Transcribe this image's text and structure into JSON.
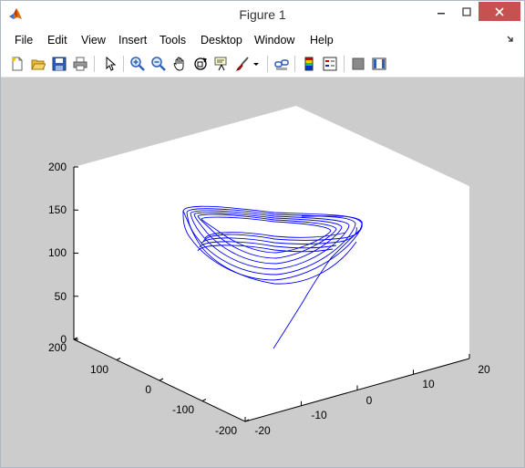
{
  "window": {
    "title": "Figure 1"
  },
  "menu": {
    "items": [
      "File",
      "Edit",
      "View",
      "Insert",
      "Tools",
      "Desktop",
      "Window",
      "Help"
    ]
  },
  "toolbar": {
    "buttons": [
      "new-figure-icon",
      "open-file-icon",
      "save-icon",
      "print-icon",
      "edit-plot-arrow-icon",
      "zoom-in-icon",
      "zoom-out-icon",
      "pan-hand-icon",
      "rotate-3d-icon",
      "data-cursor-icon",
      "brush-icon",
      "link-plot-icon",
      "insert-colorbar-icon",
      "insert-legend-icon",
      "hide-plot-tools-icon",
      "show-plot-tools-icon"
    ]
  },
  "colors": {
    "plot_line": "#0000ff",
    "figure_bg": "#cccccc",
    "axes_bg": "#ffffff",
    "close_button": "#c75050"
  },
  "chart_data": {
    "type": "line",
    "projection": "3d",
    "title": "",
    "axes": {
      "x": {
        "ticks": [
          "-20",
          "-10",
          "0",
          "10",
          "20"
        ],
        "lim": [
          -20,
          20
        ]
      },
      "y": {
        "ticks": [
          "-200",
          "-100",
          "0",
          "100",
          "200"
        ],
        "lim": [
          -200,
          200
        ]
      },
      "z": {
        "ticks": [
          "0",
          "50",
          "100",
          "150",
          "200"
        ],
        "lim": [
          0,
          200
        ]
      }
    },
    "grid": false,
    "series": [
      {
        "color": "#0000ff",
        "description_shape": "butterfly-like attractor trajectory spiraling outward in loops"
      }
    ]
  }
}
